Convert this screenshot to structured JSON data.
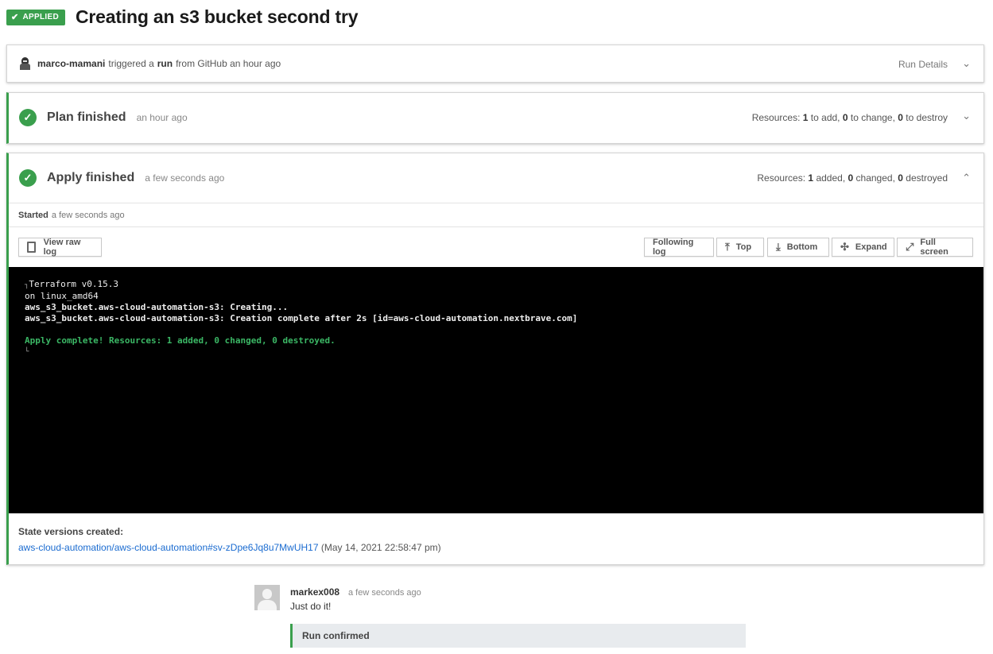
{
  "header": {
    "status_badge": "APPLIED",
    "title": "Creating an s3 bucket second try"
  },
  "trigger": {
    "user": "marco-mamani",
    "text_1": "triggered a",
    "run_word": "run",
    "text_2": "from GitHub an hour ago",
    "details_label": "Run Details"
  },
  "plan": {
    "title": "Plan finished",
    "time": "an hour ago",
    "resources_prefix": "Resources:",
    "add": "1",
    "add_label": "to add,",
    "change": "0",
    "change_label": "to change,",
    "destroy": "0",
    "destroy_label": "to destroy"
  },
  "apply": {
    "title": "Apply finished",
    "time": "a few seconds ago",
    "resources_prefix": "Resources:",
    "added": "1",
    "added_label": "added,",
    "changed": "0",
    "changed_label": "changed,",
    "destroyed": "0",
    "destroyed_label": "destroyed",
    "started_label": "Started",
    "started_time": "a few seconds ago",
    "toolbar": {
      "view_raw_log": "View raw log",
      "following_log": "Following log",
      "top": "Top",
      "bottom": "Bottom",
      "expand": "Expand",
      "full_screen": "Full screen"
    },
    "log": {
      "line1": "Terraform v0.15.3",
      "line2": "on linux_amd64",
      "line3": "aws_s3_bucket.aws-cloud-automation-s3: Creating...",
      "line4": "aws_s3_bucket.aws-cloud-automation-s3: Creation complete after 2s [id=aws-cloud-automation.nextbrave.com]",
      "line5": "Apply complete! Resources: 1 added, 0 changed, 0 destroyed."
    },
    "state_label": "State versions created:",
    "state_link": "aws-cloud-automation/aws-cloud-automation#sv-zDpe6Jq8u7MwUH17",
    "state_date": "(May 14, 2021 22:58:47 pm)"
  },
  "comment": {
    "author": "markex008",
    "time": "a few seconds ago",
    "text": "Just do it!",
    "run_confirmed": "Run confirmed"
  },
  "colors": {
    "success_green": "#3a9f4d",
    "link_blue": "#1a6bd0",
    "terminal_bg": "#000000"
  }
}
